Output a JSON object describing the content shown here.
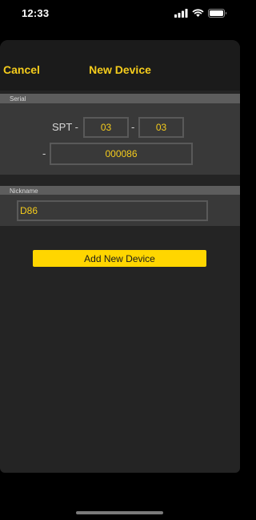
{
  "status_bar": {
    "time": "12:33",
    "icons": [
      "signal-icon",
      "wifi-icon",
      "battery-icon"
    ]
  },
  "nav": {
    "cancel_label": "Cancel",
    "title": "New Device"
  },
  "serial": {
    "header": "Serial",
    "prefix_label": "SPT -",
    "separator_1": "-",
    "field_1_value": "03",
    "field_2_value": "03",
    "separator_2": "-",
    "field_3_value": "000086"
  },
  "nickname": {
    "header": "Nickname",
    "value": "D86"
  },
  "actions": {
    "add_label": "Add New Device"
  },
  "colors": {
    "accent": "#f5cc1c",
    "button": "#ffd600",
    "background": "#242424",
    "section_header": "#5d5d5d",
    "section_body": "#393939"
  }
}
